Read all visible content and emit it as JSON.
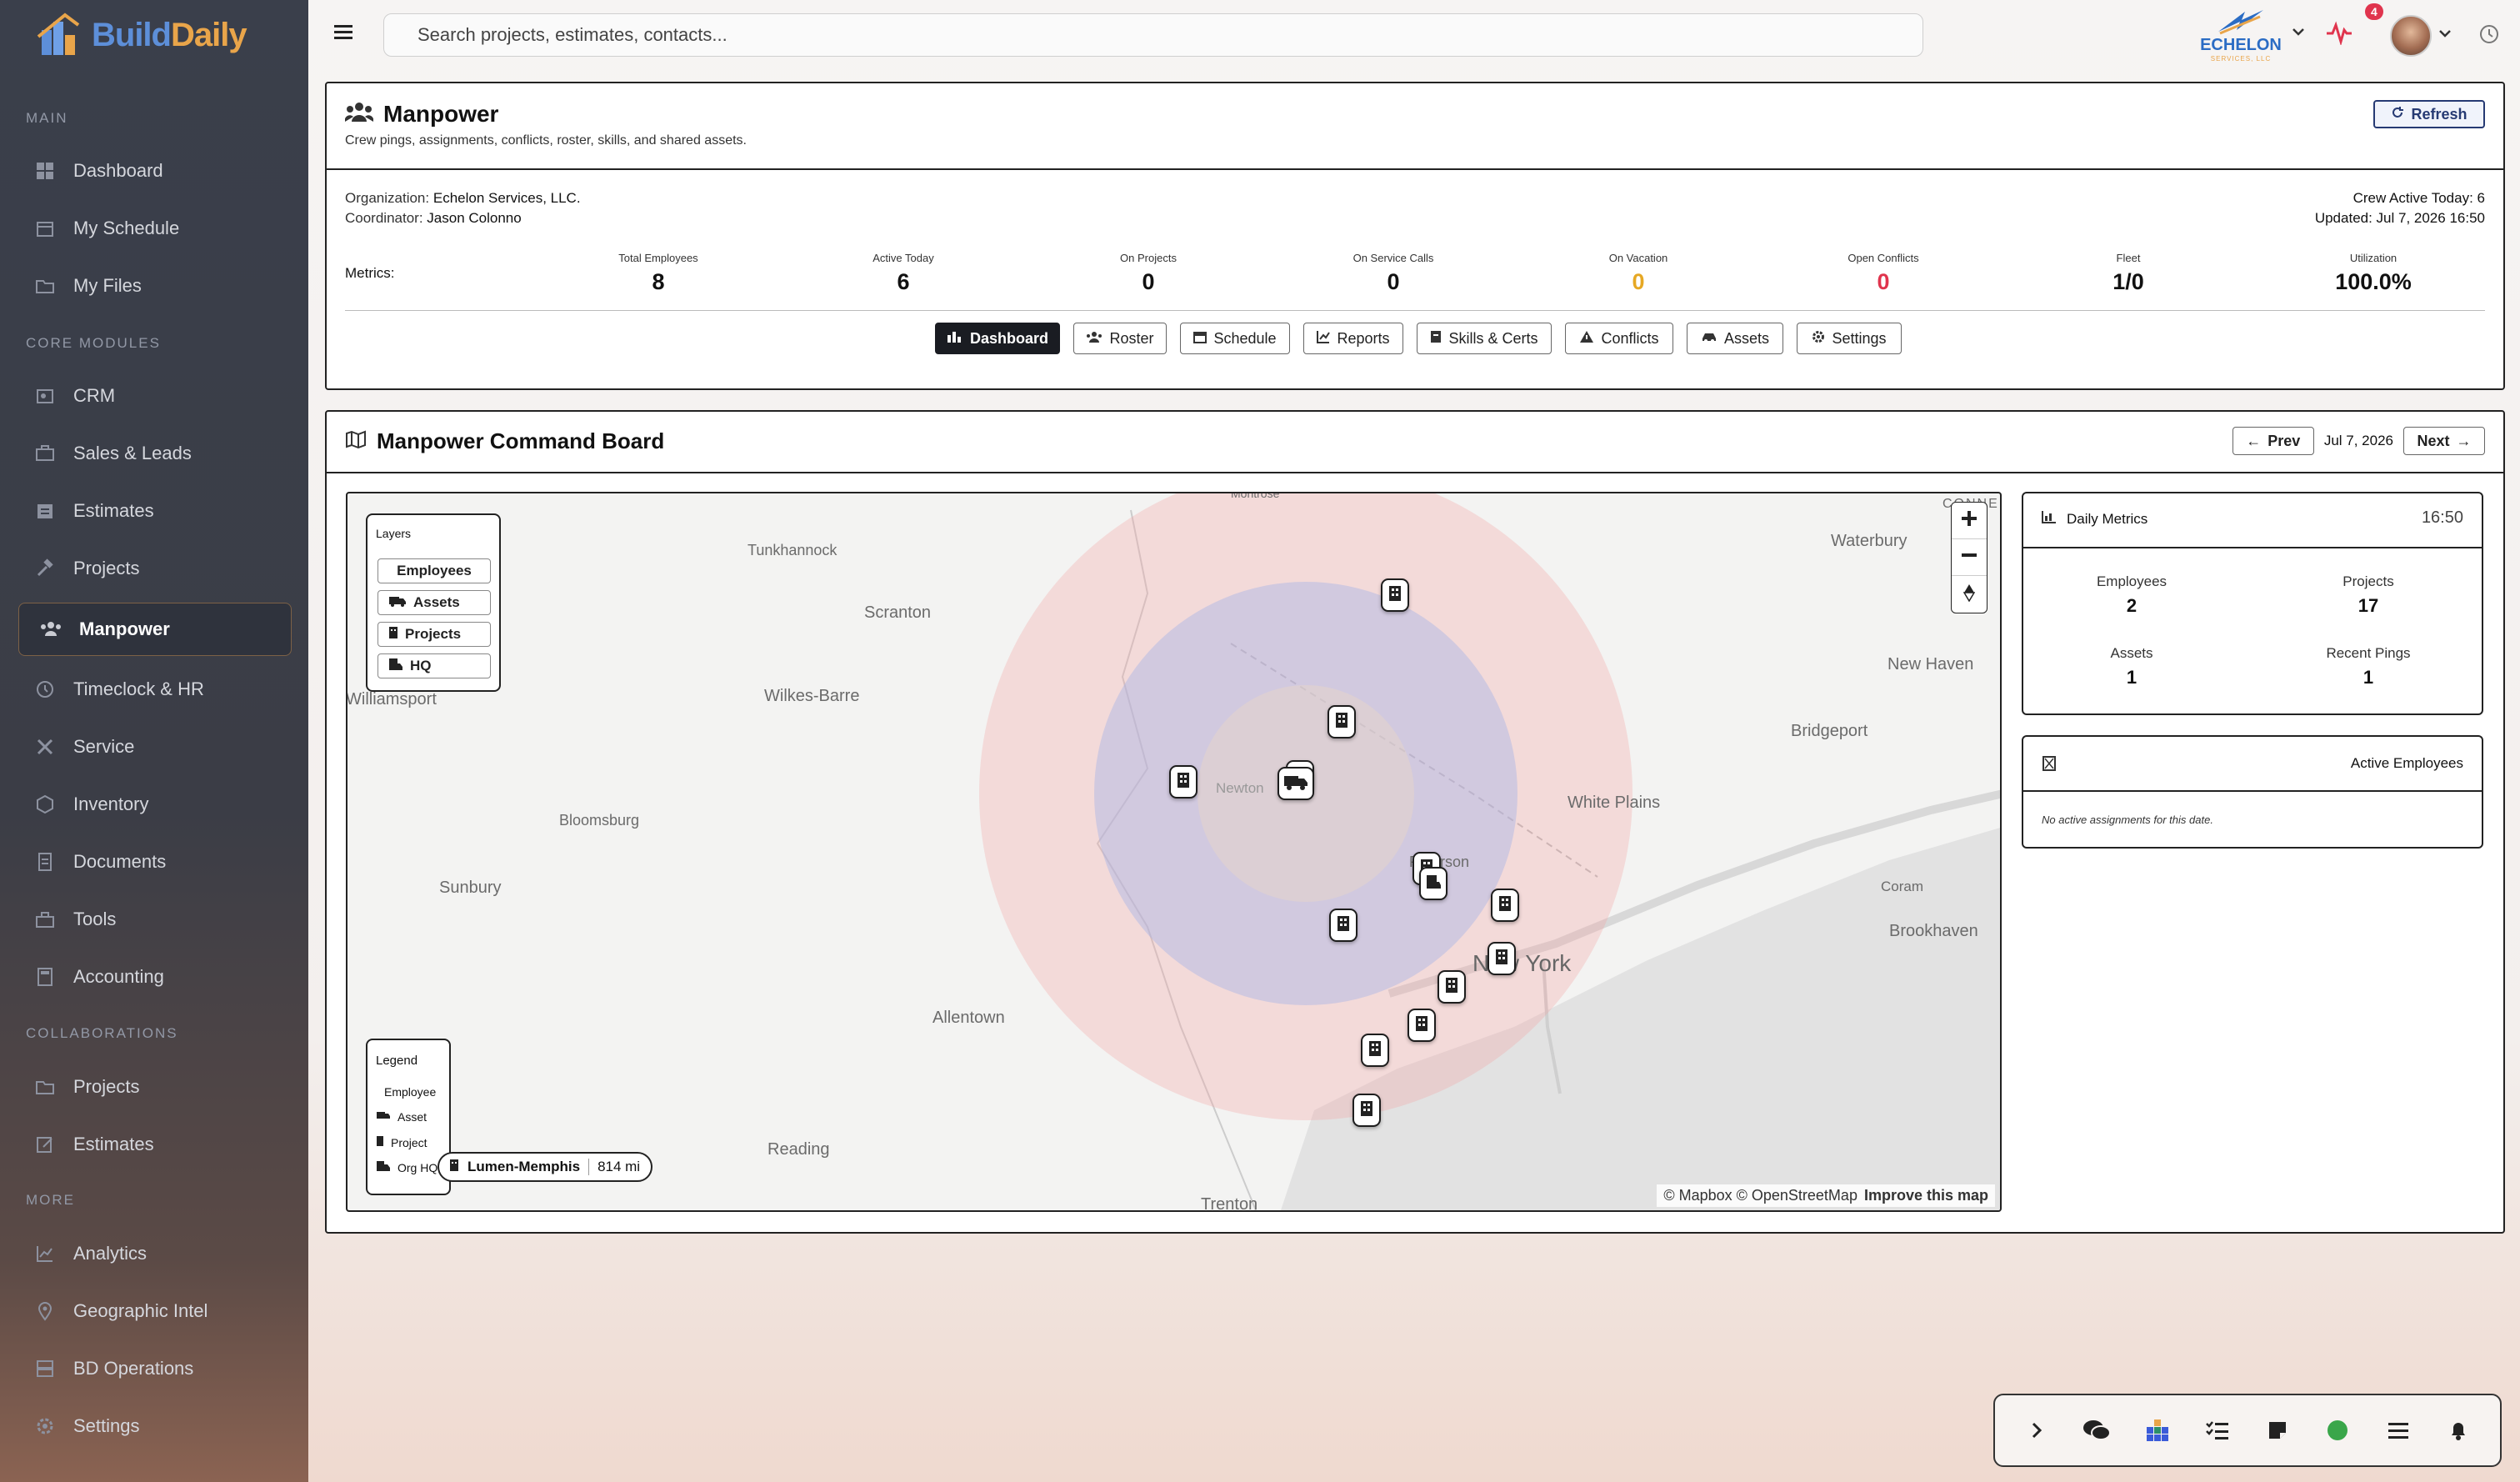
{
  "brand": {
    "name_part1": "Build",
    "name_part2": "Daily"
  },
  "sidebar": {
    "sections": {
      "main": "MAIN",
      "core": "CORE MODULES",
      "collab": "COLLABORATIONS",
      "more": "MORE"
    },
    "items": [
      {
        "label": "Dashboard",
        "icon": "dashboard-icon"
      },
      {
        "label": "My Schedule",
        "icon": "calendar-icon"
      },
      {
        "label": "My Files",
        "icon": "folder-icon"
      },
      {
        "label": "CRM",
        "icon": "crm-icon"
      },
      {
        "label": "Sales & Leads",
        "icon": "briefcase-icon"
      },
      {
        "label": "Estimates",
        "icon": "estimates-icon"
      },
      {
        "label": "Projects",
        "icon": "hammer-icon"
      },
      {
        "label": "Manpower",
        "icon": "users-icon"
      },
      {
        "label": "Timeclock & HR",
        "icon": "clock-icon"
      },
      {
        "label": "Service",
        "icon": "wrench-icon"
      },
      {
        "label": "Inventory",
        "icon": "box-icon"
      },
      {
        "label": "Documents",
        "icon": "document-icon"
      },
      {
        "label": "Tools",
        "icon": "toolbox-icon"
      },
      {
        "label": "Accounting",
        "icon": "calculator-icon"
      },
      {
        "label": "Projects",
        "icon": "projects-icon"
      },
      {
        "label": "Estimates",
        "icon": "edit-icon"
      },
      {
        "label": "Analytics",
        "icon": "chart-icon"
      },
      {
        "label": "Geographic Intel",
        "icon": "map-pin-icon"
      },
      {
        "label": "BD Operations",
        "icon": "database-icon"
      },
      {
        "label": "Settings",
        "icon": "gear-icon"
      }
    ]
  },
  "topbar": {
    "search_placeholder": "Search projects, estimates, contacts...",
    "org_logo": "ECHELON",
    "org_logo_sub": "SERVICES, LLC",
    "notification_count": "4"
  },
  "header": {
    "title": "Manpower",
    "subtitle": "Crew pings, assignments, conflicts, roster, skills, and shared assets.",
    "refresh_label": "Refresh",
    "org_label": "Organization:",
    "org_value": "Echelon Services, LLC.",
    "coord_label": "Coordinator:",
    "coord_value": "Jason Colonno",
    "crew_active": "Crew Active Today: 6",
    "updated": "Updated: Jul 7, 2026 16:50",
    "metrics_label": "Metrics:",
    "metrics": [
      {
        "label": "Total Employees",
        "value": "8",
        "color": "#111111"
      },
      {
        "label": "Active Today",
        "value": "6",
        "color": "#111111"
      },
      {
        "label": "On Projects",
        "value": "0",
        "color": "#111111"
      },
      {
        "label": "On Service Calls",
        "value": "0",
        "color": "#111111"
      },
      {
        "label": "On Vacation",
        "value": "0",
        "color": "#e6a824"
      },
      {
        "label": "Open Conflicts",
        "value": "0",
        "color": "#e0344d"
      },
      {
        "label": "Fleet",
        "value": "1/0",
        "color": "#111111"
      },
      {
        "label": "Utilization",
        "value": "100.0%",
        "color": "#111111"
      }
    ],
    "tabs": [
      "Dashboard",
      "Roster",
      "Schedule",
      "Reports",
      "Skills & Certs",
      "Conflicts",
      "Assets",
      "Settings"
    ]
  },
  "board": {
    "title": "Manpower Command Board",
    "prev_label": "Prev",
    "date": "Jul 7, 2026",
    "next_label": "Next"
  },
  "map": {
    "layers_title": "Layers",
    "layers": [
      "Employees",
      "Assets",
      "Projects",
      "HQ"
    ],
    "legend_title": "Legend",
    "legend": [
      "Employee",
      "Asset",
      "Project",
      "Org HQ"
    ],
    "places": [
      "Tunkhannock",
      "Scranton",
      "Wilkes-Barre",
      "Williamsport",
      "Bloomsburg",
      "Sunbury",
      "Allentown",
      "Reading",
      "Trenton",
      "Newton",
      "Paterson",
      "New York",
      "White Plains",
      "Waterbury",
      "New Haven",
      "Bridgeport",
      "Coram",
      "Brookhaven",
      "Montrose",
      "CONNE"
    ],
    "hq_label": "Lumen-Memphis",
    "hq_distance": "814 mi",
    "attribution": "© Mapbox © OpenStreetMap",
    "improve": "Improve this map"
  },
  "daily": {
    "title": "Daily Metrics",
    "time": "16:50",
    "items": [
      {
        "label": "Employees",
        "value": "2"
      },
      {
        "label": "Projects",
        "value": "17"
      },
      {
        "label": "Assets",
        "value": "1"
      },
      {
        "label": "Recent Pings",
        "value": "1"
      }
    ]
  },
  "active": {
    "title": "Active Employees",
    "empty": "No active assignments for this date."
  },
  "colors": {
    "accent": "#e9a54a",
    "danger": "#e0344d",
    "warning": "#e6a824",
    "sidebar": "#3a3f4b"
  }
}
